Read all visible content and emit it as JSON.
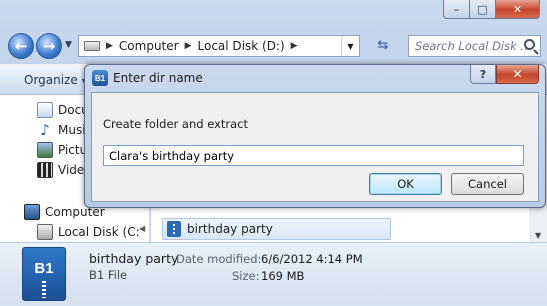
{
  "explorer": {
    "caption_buttons": {
      "minimize": "–",
      "maximize": "□",
      "close": "✕"
    },
    "address_crumbs": [
      "Computer",
      "Local Disk (D:)"
    ],
    "search_placeholder": "Search Local Disk ...",
    "organize_label": "Organize",
    "nav_items": [
      {
        "label": "Docu",
        "icon": "documents-icon"
      },
      {
        "label": "Musi",
        "icon": "music-icon"
      },
      {
        "label": "Pictu",
        "icon": "pictures-icon"
      },
      {
        "label": "Video",
        "icon": "videos-icon"
      }
    ],
    "computer_label": "Computer",
    "local_disk_label": "Local Disk (C:",
    "file_row_name": "birthday party",
    "details": {
      "icon_text": "B1",
      "name": "birthday party",
      "type": "B1 File",
      "date_modified_label": "Date modified:",
      "date_modified_value": "6/6/2012 4:14 PM",
      "size_label": "Size:",
      "size_value": "169 MB"
    }
  },
  "dialog": {
    "app_icon_text": "B1",
    "title": "Enter dir name",
    "help_label": "?",
    "close_label": "✕",
    "prompt": "Create folder and extract",
    "input_value": "Clara's birthday party",
    "ok_label": "OK",
    "cancel_label": "Cancel"
  },
  "colors": {
    "accent": "#3c7fb1",
    "b1_blue": "#2d69b4",
    "close_red": "#c5452b"
  }
}
